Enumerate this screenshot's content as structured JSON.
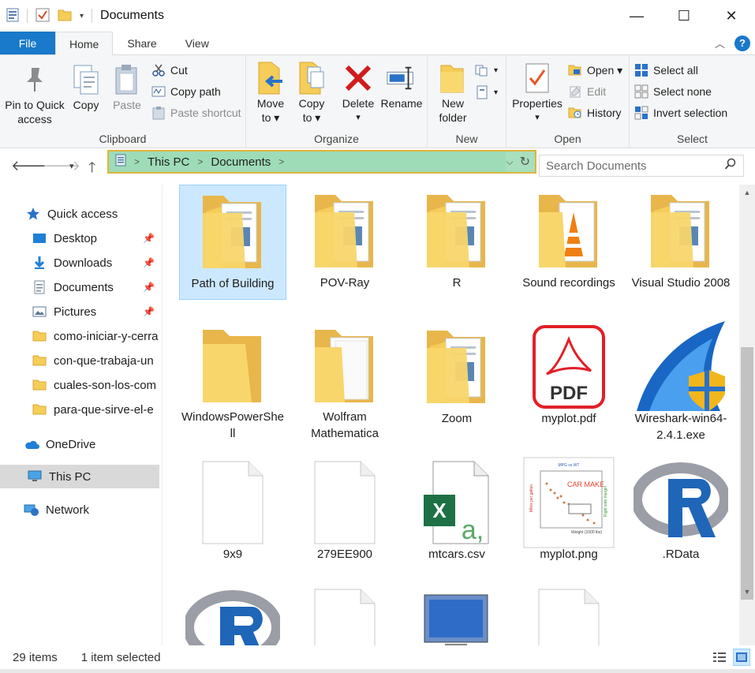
{
  "window": {
    "title": "Documents",
    "minimize": "—",
    "maximize": "☐",
    "close": "✕"
  },
  "tabs": [
    {
      "label": "File"
    },
    {
      "label": "Home"
    },
    {
      "label": "Share"
    },
    {
      "label": "View"
    }
  ],
  "ribbon": {
    "clipboard": {
      "label": "Clipboard",
      "pin_line1": "Pin to Quick",
      "pin_line2": "access",
      "copy": "Copy",
      "paste": "Paste",
      "cut": "Cut",
      "copy_path": "Copy path",
      "paste_shortcut": "Paste shortcut"
    },
    "organize": {
      "label": "Organize",
      "move_to_line1": "Move",
      "move_to_line2": "to ▾",
      "copy_to_line1": "Copy",
      "copy_to_line2": "to ▾",
      "delete": "Delete",
      "delete_arrow": "▾",
      "rename": "Rename"
    },
    "new": {
      "label": "New",
      "new_folder_line1": "New",
      "new_folder_line2": "folder"
    },
    "open": {
      "label": "Open",
      "properties": "Properties",
      "properties_arrow": "▾",
      "open": "Open ▾",
      "edit": "Edit",
      "history": "History"
    },
    "select": {
      "label": "Select",
      "select_all": "Select all",
      "select_none": "Select none",
      "invert": "Invert selection"
    }
  },
  "address": {
    "crumbs": [
      "This PC",
      "Documents"
    ],
    "search_placeholder": "Search Documents"
  },
  "nav": {
    "quick_access": "Quick access",
    "items": [
      {
        "label": "Desktop",
        "pinned": true
      },
      {
        "label": "Downloads",
        "pinned": true
      },
      {
        "label": "Documents",
        "pinned": true
      },
      {
        "label": "Pictures",
        "pinned": true
      },
      {
        "label": "como-iniciar-y-cerra",
        "pinned": false
      },
      {
        "label": "con-que-trabaja-un",
        "pinned": false
      },
      {
        "label": "cuales-son-los-com",
        "pinned": false
      },
      {
        "label": "para-que-sirve-el-e",
        "pinned": false
      }
    ],
    "onedrive": "OneDrive",
    "this_pc": "This PC",
    "network": "Network"
  },
  "files": [
    {
      "name": "Path of Building",
      "type": "folder-docs"
    },
    {
      "name": "POV-Ray",
      "type": "folder-docs"
    },
    {
      "name": "R",
      "type": "folder-docs"
    },
    {
      "name": "Sound recordings",
      "type": "folder-vlc"
    },
    {
      "name": "Visual Studio 2008",
      "type": "folder-docs"
    },
    {
      "name": "WindowsPowerShell",
      "type": "folder"
    },
    {
      "name": "Wolfram Mathematica",
      "type": "folder-white"
    },
    {
      "name": "Zoom",
      "type": "folder-docs"
    },
    {
      "name": "myplot.pdf",
      "type": "pdf"
    },
    {
      "name": "Wireshark-win64-2.4.1.exe",
      "type": "wireshark"
    },
    {
      "name": "9x9",
      "type": "blank"
    },
    {
      "name": "279EE900",
      "type": "blank"
    },
    {
      "name": "mtcars.csv",
      "type": "excel"
    },
    {
      "name": "myplot.png",
      "type": "plot"
    },
    {
      "name": ".RData",
      "type": "r"
    },
    {
      "name": "",
      "type": "r"
    },
    {
      "name": "",
      "type": "blank"
    },
    {
      "name": "",
      "type": "monitor"
    },
    {
      "name": "",
      "type": "blank"
    },
    {
      "name": "",
      "type": "none"
    }
  ],
  "plot_thumb": {
    "title": "MPG vs WT",
    "annotation": "CAR MAKE",
    "xlabel": "Weight (1000 lbs)",
    "ylabel": "Miles per gallon",
    "right_label": "Right side margin"
  },
  "excel_letter": "X",
  "excel_a": "a,",
  "pdf_text": "PDF",
  "status": {
    "count": "29 items",
    "selected": "1 item selected"
  },
  "colors": {
    "file_tab": "#1979ca",
    "address_highlight": "#9edcb8",
    "address_border": "#e0b43a",
    "selection": "#cce8ff",
    "folder": "#f5cd58"
  }
}
